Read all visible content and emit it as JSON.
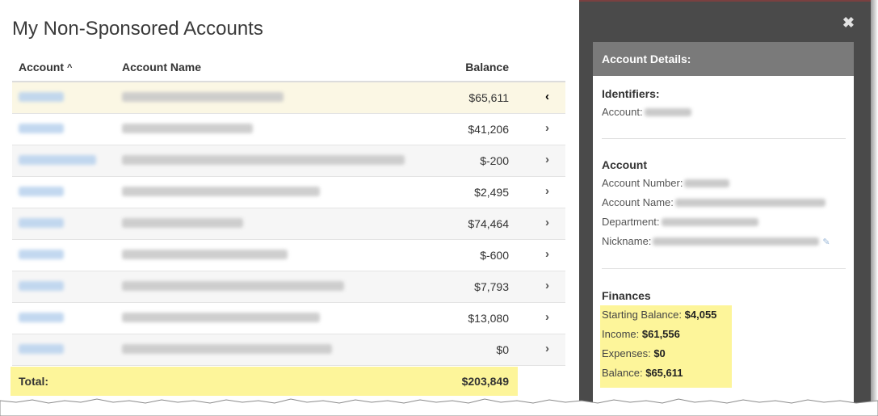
{
  "page": {
    "title": "My Non-Sponsored Accounts"
  },
  "table": {
    "columns": {
      "account": "Account",
      "name": "Account Name",
      "balance": "Balance"
    },
    "sort_icon": "caret-up-icon",
    "rows": [
      {
        "balance": "$65,611",
        "selected": true
      },
      {
        "balance": "$41,206"
      },
      {
        "balance": "$-200"
      },
      {
        "balance": "$2,495"
      },
      {
        "balance": "$74,464"
      },
      {
        "balance": "$-600"
      },
      {
        "balance": "$7,793"
      },
      {
        "balance": "$13,080"
      },
      {
        "balance": "$0"
      }
    ],
    "total_label": "Total:",
    "total_value": "$203,849"
  },
  "details": {
    "close_icon": "close-icon",
    "header": "Account Details:",
    "identifiers": {
      "title": "Identifiers:",
      "account_label": "Account:"
    },
    "account": {
      "title": "Account",
      "number_label": "Account Number:",
      "name_label": "Account Name:",
      "department_label": "Department:",
      "nickname_label": "Nickname:"
    },
    "finances": {
      "title": "Finances",
      "starting_label": "Starting Balance:",
      "starting_value": "$4,055",
      "income_label": "Income:",
      "income_value": "$61,556",
      "expenses_label": "Expenses:",
      "expenses_value": "$0",
      "balance_label": "Balance:",
      "balance_value": "$65,611"
    }
  },
  "colors": {
    "highlight": "#fdf59a",
    "panel_dark": "#4a4a4a",
    "details_header": "#7a7a7a",
    "link": "#3d7fc9"
  }
}
